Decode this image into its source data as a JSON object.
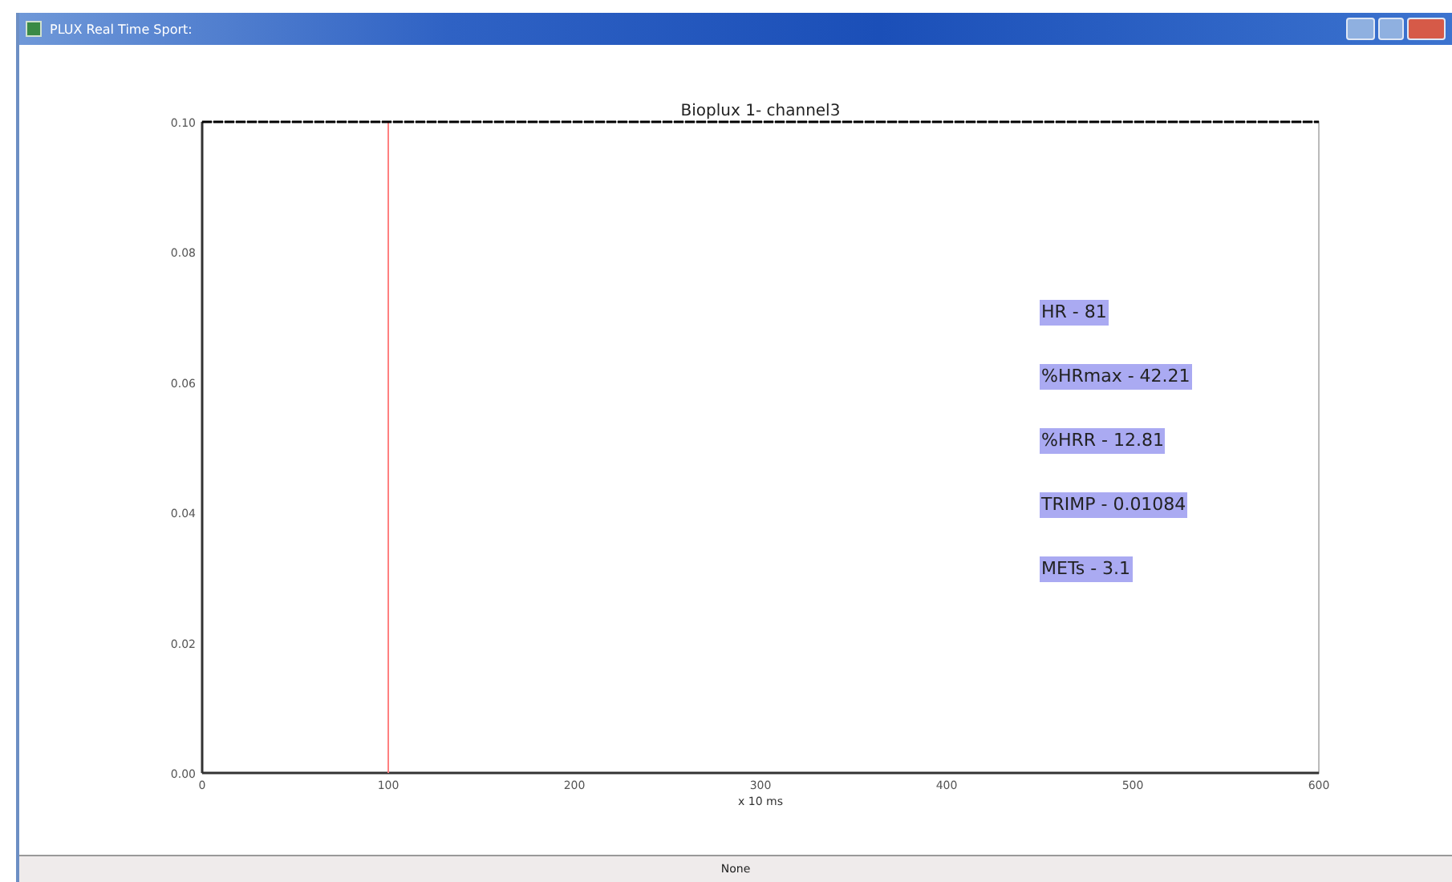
{
  "window": {
    "title": "PLUX Real Time Sport:"
  },
  "plot": {
    "chart_data": {
      "type": "line",
      "title": "Bioplux 1- channel3",
      "xlabel": "x 10 ms",
      "xlim": [
        0,
        600
      ],
      "ylim": [
        0,
        0.1
      ],
      "xticks": [
        0,
        100,
        200,
        300,
        400,
        500,
        600
      ],
      "yticks": [
        {
          "value": 0,
          "label": "0.00"
        },
        {
          "value": 0.02,
          "label": "0.02"
        },
        {
          "value": 0.04,
          "label": "0.04"
        },
        {
          "value": 0.06,
          "label": "0.06"
        },
        {
          "value": 0.08,
          "label": "0.08"
        },
        {
          "value": 0.1,
          "label": "0.10"
        }
      ],
      "x": [
        0,
        600
      ],
      "series": [
        {
          "color": "#000000",
          "line_style": "dashed",
          "values": [
            0.1,
            0.1
          ]
        }
      ],
      "ref_lines": [
        {
          "axis": "x",
          "value": 100,
          "color": "#ff8080"
        }
      ]
    },
    "metrics": [
      "HR - 81",
      "%HRmax - 42.21",
      "%HRR - 12.81",
      "TRIMP - 0.01084",
      "METs - 3.1"
    ]
  },
  "status_bar": {
    "text": "None"
  }
}
